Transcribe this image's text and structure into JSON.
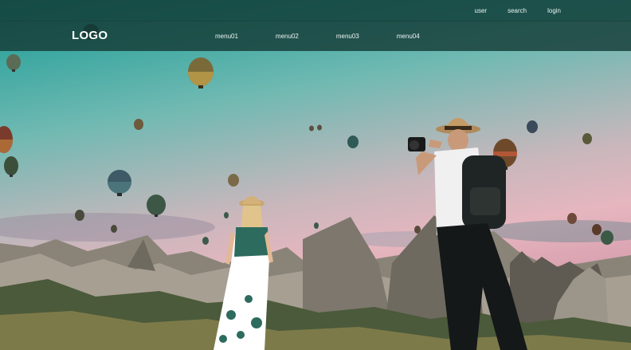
{
  "top_links": {
    "user": "user",
    "search": "search",
    "login": "login"
  },
  "navbar": {
    "logo": "LOGO",
    "menu": [
      "menu01",
      "menu02",
      "menu03",
      "menu04"
    ]
  },
  "colors": {
    "topbar": "#14423c",
    "navbar": "#163c37",
    "sky_top": "#1f8a85",
    "sky_pink": "#e6b6bf"
  },
  "hero": {
    "image_description_icon": "balloons-landscape-photo"
  }
}
